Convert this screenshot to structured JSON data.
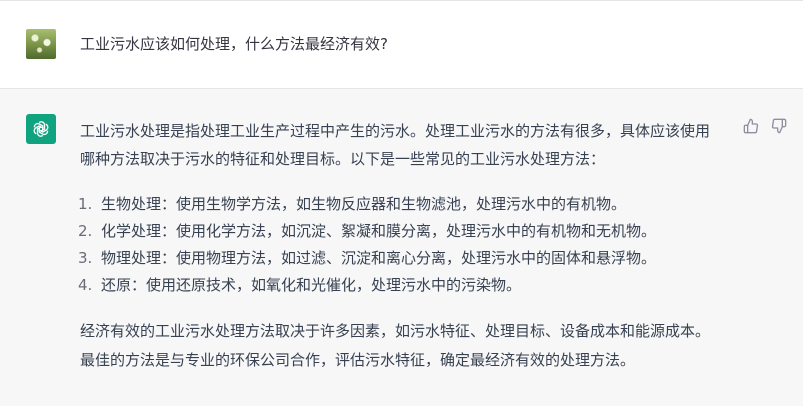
{
  "user": {
    "message": "工业污水应该如何处理，什么方法最经济有效?"
  },
  "assistant": {
    "intro": "工业污水处理是指处理工业生产过程中产生的污水。处理工业污水的方法有很多，具体应该使用哪种方法取决于污水的特征和处理目标。以下是一些常见的工业污水处理方法：",
    "items": [
      {
        "num": "1.",
        "text": "生物处理：使用生物学方法，如生物反应器和生物滤池，处理污水中的有机物。"
      },
      {
        "num": "2.",
        "text": "化学处理：使用化学方法，如沉淀、絮凝和膜分离，处理污水中的有机物和无机物。"
      },
      {
        "num": "3.",
        "text": "物理处理：使用物理方法，如过滤、沉淀和离心分离，处理污水中的固体和悬浮物。"
      },
      {
        "num": "4.",
        "text": "还原：使用还原技术，如氧化和光催化，处理污水中的污染物。"
      }
    ],
    "conclusion": "经济有效的工业污水处理方法取决于许多因素，如污水特征、处理目标、设备成本和能源成本。最佳的方法是与专业的环保公司合作，评估污水特征，确定最经济有效的处理方法。"
  },
  "icons": {
    "avatar_bot": "openai-logo-icon",
    "thumbs_up": "thumbs-up-icon",
    "thumbs_down": "thumbs-down-icon"
  },
  "colors": {
    "bot_avatar": "#10a37f",
    "bot_bg": "#f7f7f8",
    "user_bg": "#ffffff"
  }
}
